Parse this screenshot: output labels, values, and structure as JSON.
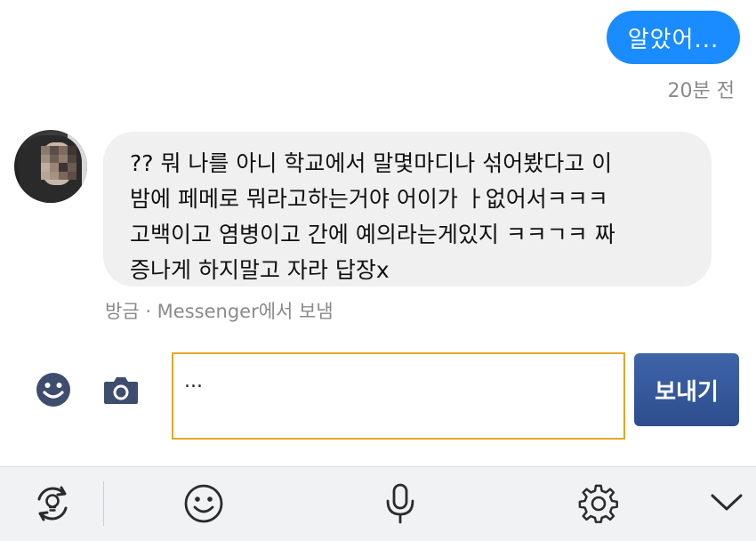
{
  "outgoing": {
    "text": "알았어...",
    "time": "20분 전"
  },
  "incoming": {
    "lines": [
      "?? 뭐 나를 아니 학교에서 말몇마디나 섞어봤다고 이",
      "밤에 페메로 뭐라고하는거야 어이가 ㅏ없어서ㅋㅋㅋ",
      "고백이고 염병이고 간에 예의라는게있지 ㅋㅋㄱㅋ 짜",
      "증나게 하지말고 자라 답장x"
    ],
    "meta": "방금 · Messenger에서 보냄"
  },
  "composer": {
    "value": "...",
    "send_label": "보내기",
    "emoji_icon": "smiley-icon",
    "camera_icon": "camera-icon"
  },
  "keyboard_toolbar": {
    "items": [
      "sync-lightbulb-icon",
      "smiley-icon",
      "microphone-icon",
      "settings-gear-icon",
      "chevron-down-icon"
    ]
  },
  "colors": {
    "outgoing_bubble": "#1a8cff",
    "incoming_bubble": "#f0f0f0",
    "input_border": "#e3a824",
    "send_button": "#2f5396",
    "meta_text": "#8a8a8a"
  }
}
